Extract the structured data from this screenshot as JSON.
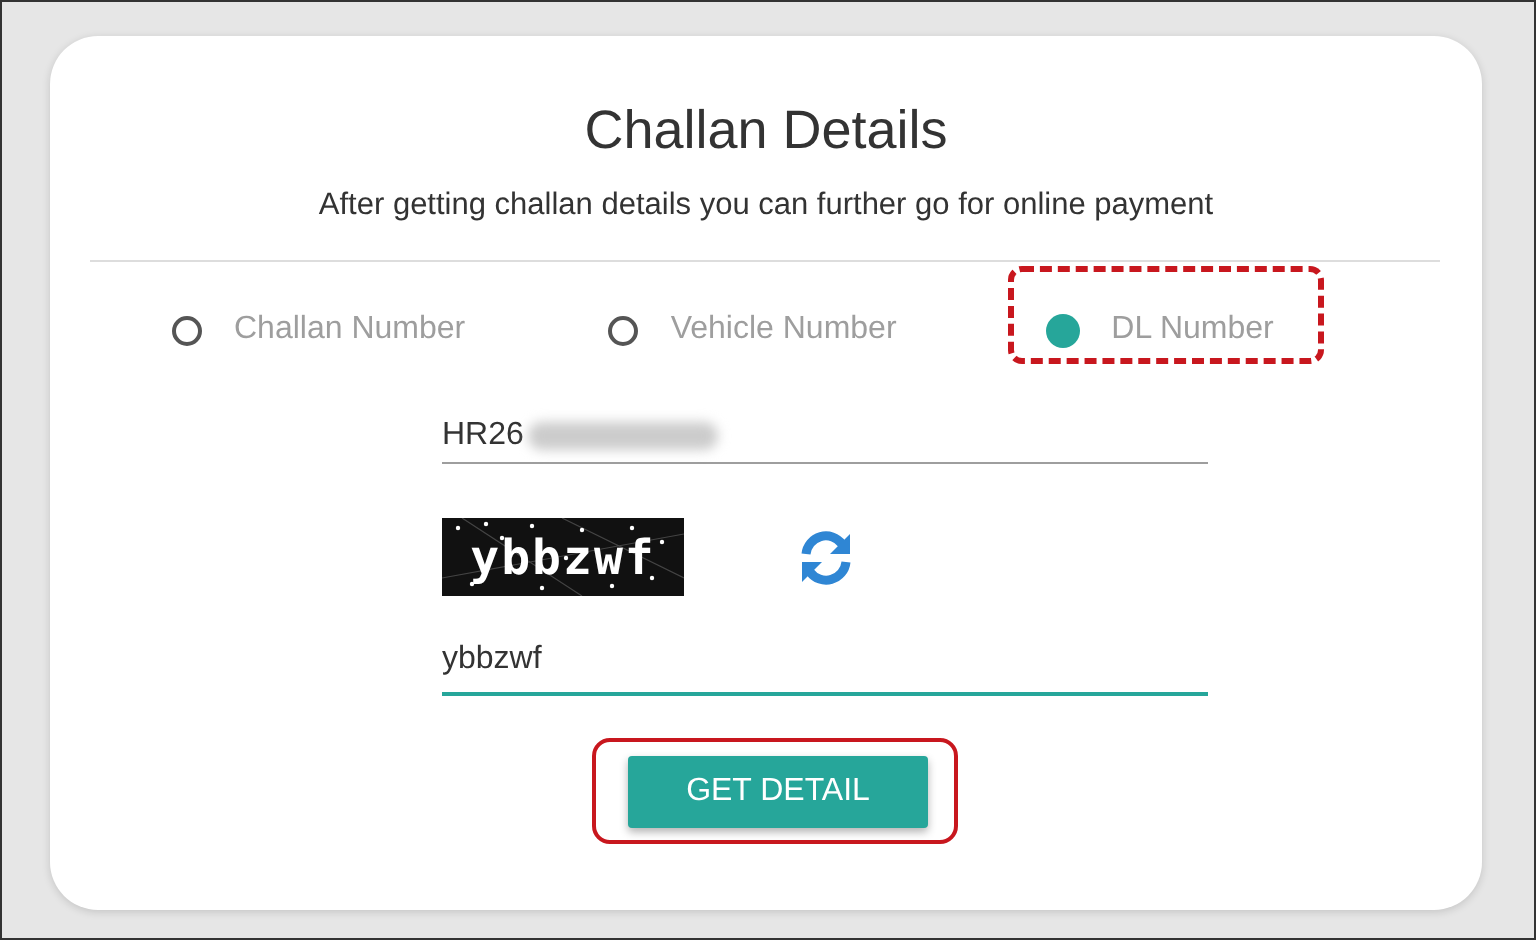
{
  "title": "Challan Details",
  "subtitle": "After getting challan details you can further go for online payment",
  "search_by": [
    {
      "label": "Challan Number",
      "selected": false,
      "highlighted": false
    },
    {
      "label": "Vehicle Number",
      "selected": false,
      "highlighted": false
    },
    {
      "label": "DL Number",
      "selected": true,
      "highlighted": true
    }
  ],
  "dl_field": {
    "value": "HR26",
    "redacted": true
  },
  "captcha": {
    "text": "ybbzwf"
  },
  "captcha_field": {
    "value": "ybbzwf",
    "focused": true
  },
  "button": {
    "label": "GET DETAIL",
    "highlighted": true
  }
}
